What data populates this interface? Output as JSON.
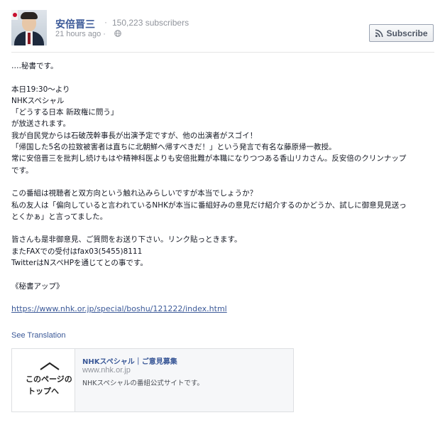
{
  "page": {
    "name": "安倍晋三",
    "separator": "·",
    "subscribers": "150,223 subscribers",
    "timestamp": "21 hours ago ·",
    "globe_icon": "globe-icon",
    "subscribe": {
      "icon": "rss-icon",
      "label": "Subscribe"
    }
  },
  "post": {
    "lines": [
      "‥‥秘書です。",
      "",
      "本日19:30～より",
      "NHKスペシャル",
      "「どうする日本 新政権に問う」",
      "が放送されます。",
      "我が自民党からは石破茂幹事長が出演予定ですが、他の出演者がスゴイ！",
      "「帰国した5名の拉致被害者は直ちに北朝鮮へ帰すべきだ！」という発言で有名な藤原帰一教授。",
      "常に安倍晋三を批判し続けもはや精神科医よりも安倍批難が本職になりつつある香山リカさん。反安倍のクリンナップ",
      "です。",
      "",
      "この番組は視聴者と双方向という触れ込みらしいですが本当でしょうか？",
      "私の友人は「偏向していると言われているNHKが本当に番組好みの意見だけ紹介するのかどうか、試しに御意見見送っ",
      "とくかぁ」と言ってました。",
      "",
      "皆さんも是非御意見、ご質問をお送り下さい。リンク貼っときます。",
      "またFAXでの受付はfax03(5455)8111",
      "TwitterはNスペHPを通じてとの事です。",
      "",
      "《秘書アップ》",
      ""
    ],
    "link": "https://www.nhk.or.jp/special/boshu/121222/index.html",
    "see_translation": "See Translation"
  },
  "link_card": {
    "thumb_icon": "chevron-up-icon",
    "thumb_line1": "このページの",
    "thumb_line2": "トップへ",
    "title": "NHKスペシャル｜ご意見募集",
    "domain": "www.nhk.or.jp",
    "description": "NHKスペシャルの番組公式サイトです。"
  },
  "colors": {
    "link": "#3b5998",
    "text": "#141823",
    "muted": "#90949c",
    "card_bg": "#f6f7f9",
    "border": "#dddfe2"
  }
}
